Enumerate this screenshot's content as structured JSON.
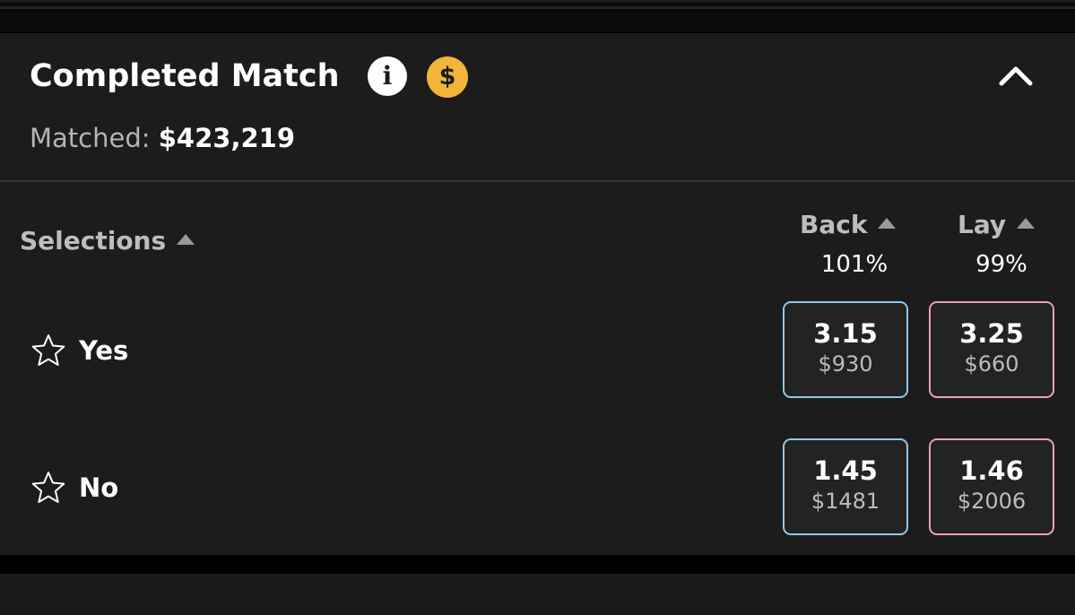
{
  "market": {
    "title": "Completed Match",
    "info_icon": "info-icon",
    "cashout_icon": "dollar-coin-icon",
    "collapse_icon": "chevron-up-icon",
    "matched_label": "Matched:",
    "matched_value": "$423,219"
  },
  "columns": {
    "selections_label": "Selections",
    "back_label": "Back",
    "lay_label": "Lay",
    "back_percent": "101%",
    "lay_percent": "99%"
  },
  "runners": [
    {
      "name": "Yes",
      "back": {
        "price": "3.15",
        "size": "$930"
      },
      "lay": {
        "price": "3.25",
        "size": "$660"
      }
    },
    {
      "name": "No",
      "back": {
        "price": "1.45",
        "size": "$1481"
      },
      "lay": {
        "price": "1.46",
        "size": "$2006"
      }
    }
  ],
  "colors": {
    "panel_bg": "#1c1c1c",
    "back_border": "#8ec9ea",
    "lay_border": "#e9a3ad",
    "coin": "#f2b53a"
  }
}
